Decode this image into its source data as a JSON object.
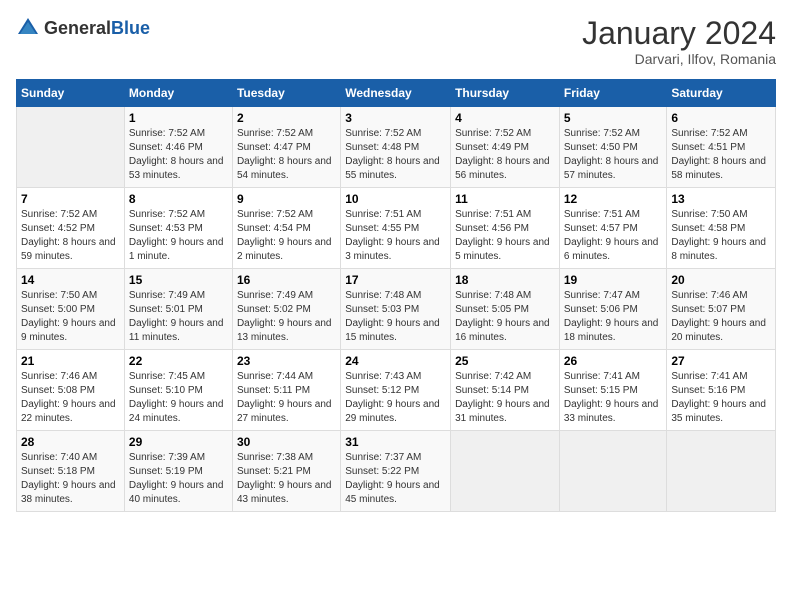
{
  "logo": {
    "general": "General",
    "blue": "Blue"
  },
  "title": "January 2024",
  "location": "Darvari, Ilfov, Romania",
  "days_of_week": [
    "Sunday",
    "Monday",
    "Tuesday",
    "Wednesday",
    "Thursday",
    "Friday",
    "Saturday"
  ],
  "weeks": [
    [
      {
        "day": "",
        "empty": true
      },
      {
        "day": "1",
        "sunrise": "7:52 AM",
        "sunset": "4:46 PM",
        "daylight": "8 hours and 53 minutes."
      },
      {
        "day": "2",
        "sunrise": "7:52 AM",
        "sunset": "4:47 PM",
        "daylight": "8 hours and 54 minutes."
      },
      {
        "day": "3",
        "sunrise": "7:52 AM",
        "sunset": "4:48 PM",
        "daylight": "8 hours and 55 minutes."
      },
      {
        "day": "4",
        "sunrise": "7:52 AM",
        "sunset": "4:49 PM",
        "daylight": "8 hours and 56 minutes."
      },
      {
        "day": "5",
        "sunrise": "7:52 AM",
        "sunset": "4:50 PM",
        "daylight": "8 hours and 57 minutes."
      },
      {
        "day": "6",
        "sunrise": "7:52 AM",
        "sunset": "4:51 PM",
        "daylight": "8 hours and 58 minutes."
      }
    ],
    [
      {
        "day": "7",
        "sunrise": "7:52 AM",
        "sunset": "4:52 PM",
        "daylight": "8 hours and 59 minutes."
      },
      {
        "day": "8",
        "sunrise": "7:52 AM",
        "sunset": "4:53 PM",
        "daylight": "9 hours and 1 minute."
      },
      {
        "day": "9",
        "sunrise": "7:52 AM",
        "sunset": "4:54 PM",
        "daylight": "9 hours and 2 minutes."
      },
      {
        "day": "10",
        "sunrise": "7:51 AM",
        "sunset": "4:55 PM",
        "daylight": "9 hours and 3 minutes."
      },
      {
        "day": "11",
        "sunrise": "7:51 AM",
        "sunset": "4:56 PM",
        "daylight": "9 hours and 5 minutes."
      },
      {
        "day": "12",
        "sunrise": "7:51 AM",
        "sunset": "4:57 PM",
        "daylight": "9 hours and 6 minutes."
      },
      {
        "day": "13",
        "sunrise": "7:50 AM",
        "sunset": "4:58 PM",
        "daylight": "9 hours and 8 minutes."
      }
    ],
    [
      {
        "day": "14",
        "sunrise": "7:50 AM",
        "sunset": "5:00 PM",
        "daylight": "9 hours and 9 minutes."
      },
      {
        "day": "15",
        "sunrise": "7:49 AM",
        "sunset": "5:01 PM",
        "daylight": "9 hours and 11 minutes."
      },
      {
        "day": "16",
        "sunrise": "7:49 AM",
        "sunset": "5:02 PM",
        "daylight": "9 hours and 13 minutes."
      },
      {
        "day": "17",
        "sunrise": "7:48 AM",
        "sunset": "5:03 PM",
        "daylight": "9 hours and 15 minutes."
      },
      {
        "day": "18",
        "sunrise": "7:48 AM",
        "sunset": "5:05 PM",
        "daylight": "9 hours and 16 minutes."
      },
      {
        "day": "19",
        "sunrise": "7:47 AM",
        "sunset": "5:06 PM",
        "daylight": "9 hours and 18 minutes."
      },
      {
        "day": "20",
        "sunrise": "7:46 AM",
        "sunset": "5:07 PM",
        "daylight": "9 hours and 20 minutes."
      }
    ],
    [
      {
        "day": "21",
        "sunrise": "7:46 AM",
        "sunset": "5:08 PM",
        "daylight": "9 hours and 22 minutes."
      },
      {
        "day": "22",
        "sunrise": "7:45 AM",
        "sunset": "5:10 PM",
        "daylight": "9 hours and 24 minutes."
      },
      {
        "day": "23",
        "sunrise": "7:44 AM",
        "sunset": "5:11 PM",
        "daylight": "9 hours and 27 minutes."
      },
      {
        "day": "24",
        "sunrise": "7:43 AM",
        "sunset": "5:12 PM",
        "daylight": "9 hours and 29 minutes."
      },
      {
        "day": "25",
        "sunrise": "7:42 AM",
        "sunset": "5:14 PM",
        "daylight": "9 hours and 31 minutes."
      },
      {
        "day": "26",
        "sunrise": "7:41 AM",
        "sunset": "5:15 PM",
        "daylight": "9 hours and 33 minutes."
      },
      {
        "day": "27",
        "sunrise": "7:41 AM",
        "sunset": "5:16 PM",
        "daylight": "9 hours and 35 minutes."
      }
    ],
    [
      {
        "day": "28",
        "sunrise": "7:40 AM",
        "sunset": "5:18 PM",
        "daylight": "9 hours and 38 minutes."
      },
      {
        "day": "29",
        "sunrise": "7:39 AM",
        "sunset": "5:19 PM",
        "daylight": "9 hours and 40 minutes."
      },
      {
        "day": "30",
        "sunrise": "7:38 AM",
        "sunset": "5:21 PM",
        "daylight": "9 hours and 43 minutes."
      },
      {
        "day": "31",
        "sunrise": "7:37 AM",
        "sunset": "5:22 PM",
        "daylight": "9 hours and 45 minutes."
      },
      {
        "day": "",
        "empty": true
      },
      {
        "day": "",
        "empty": true
      },
      {
        "day": "",
        "empty": true
      }
    ]
  ],
  "labels": {
    "sunrise": "Sunrise:",
    "sunset": "Sunset:",
    "daylight": "Daylight:"
  }
}
